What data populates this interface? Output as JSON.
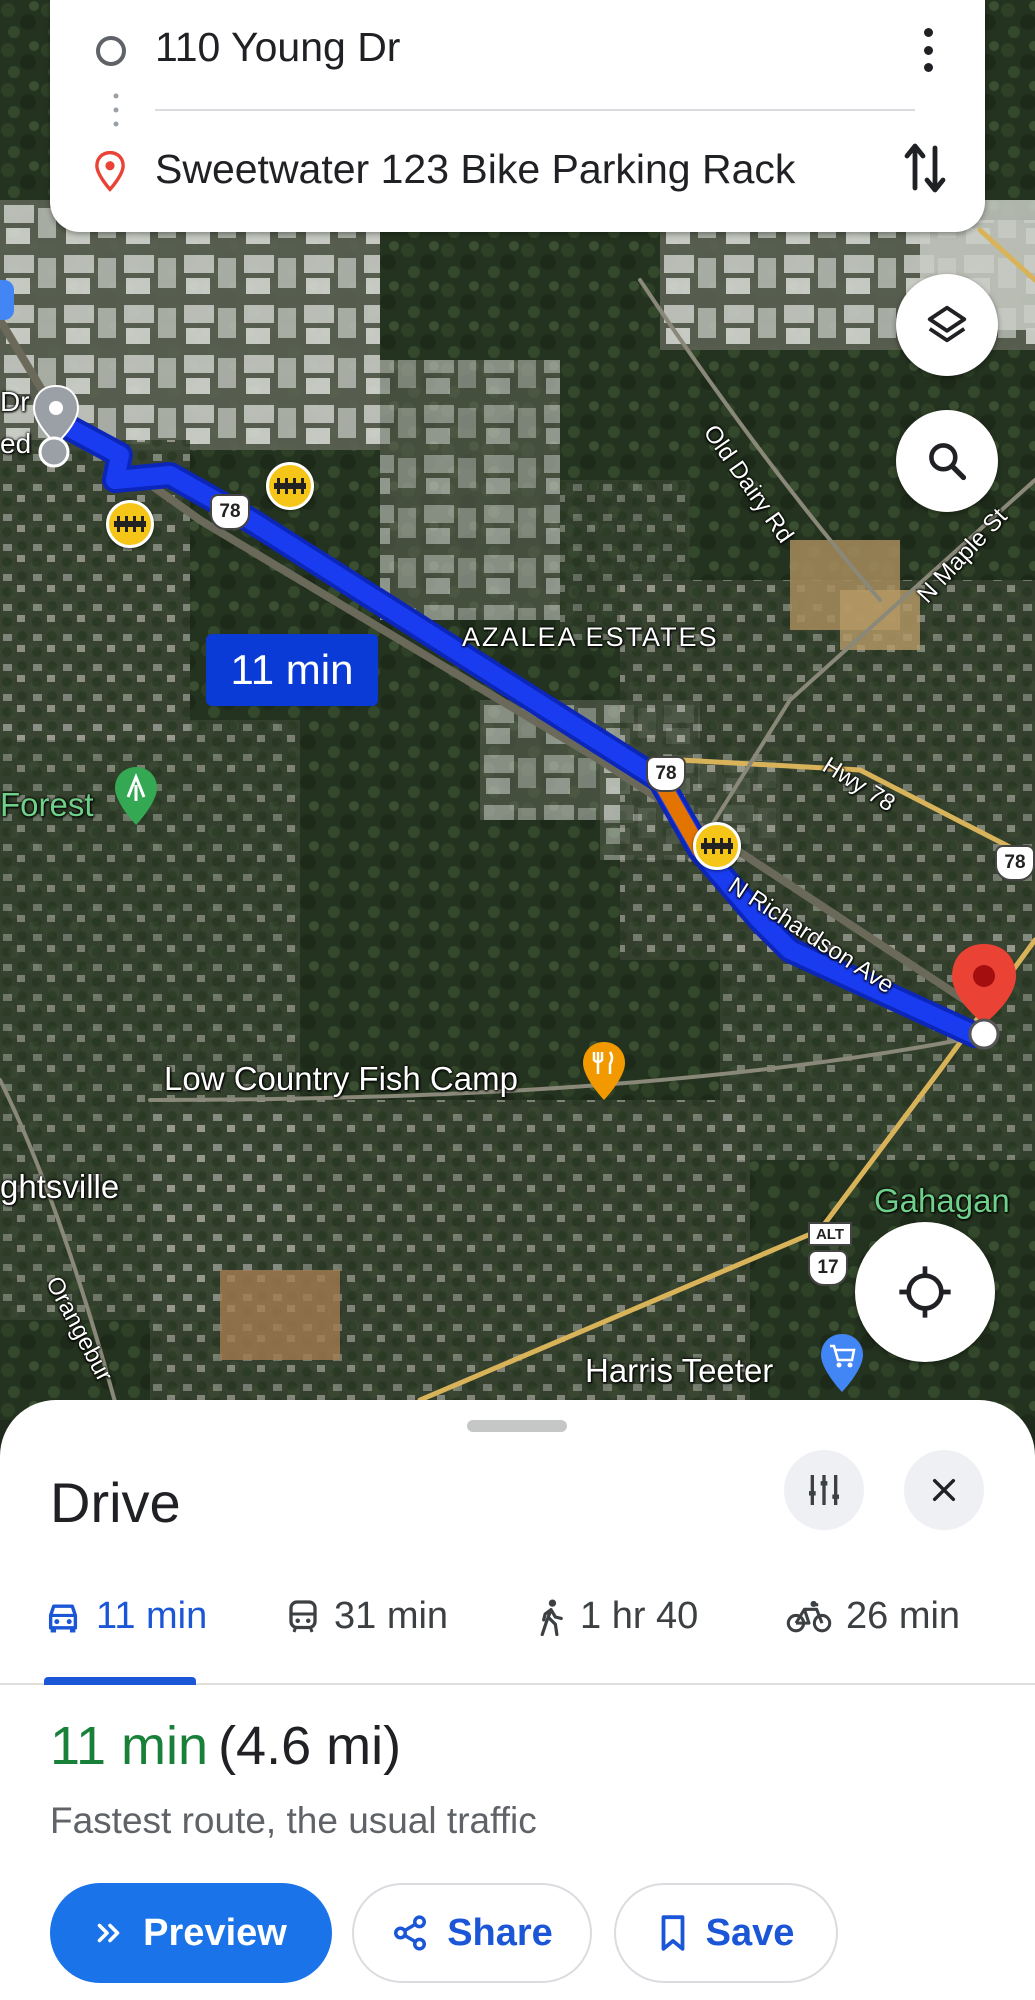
{
  "search": {
    "origin": "110 Young Dr",
    "destination": "Sweetwater 123 Bike Parking Rack"
  },
  "map": {
    "route_time_badge": "11 min",
    "labels": {
      "old_dairy": "Old Dairy Rd",
      "n_maple": "N Maple St",
      "azalea": "AZALEA ESTATES",
      "hwy78": "Hwy 78",
      "n_richardson": "N Richardson Ave",
      "forest": "Forest",
      "low_country": "Low Country Fish Camp",
      "ghtsville": "ghtsville",
      "gahagan": "Gahagan",
      "harris": "Harris Teeter",
      "orangeburg": "Orangebur",
      "edge_dr": "Dr",
      "edge_ed": "ed"
    },
    "shields": {
      "s78a": "78",
      "s78b": "78",
      "s78c": "78",
      "s17": "17",
      "alt": "ALT"
    }
  },
  "sheet": {
    "title": "Drive",
    "modes": [
      {
        "name": "drive",
        "label": "11 min",
        "icon": "car-icon",
        "active": true
      },
      {
        "name": "transit",
        "label": "31 min",
        "icon": "transit-icon",
        "active": false
      },
      {
        "name": "walk",
        "label": "1 hr 40",
        "icon": "walk-icon",
        "active": false
      },
      {
        "name": "bike",
        "label": "26 min",
        "icon": "bike-icon",
        "active": false
      }
    ],
    "summary_duration": "11 min",
    "summary_distance": "(4.6 mi)",
    "route_description": "Fastest route, the usual traffic",
    "buttons": {
      "preview": "Preview",
      "share": "Share",
      "save": "Save"
    }
  },
  "colors": {
    "route": "#1a3cf0",
    "accent": "#1a73e8",
    "duration_green": "#188038",
    "destination_pin": "#ea4335"
  }
}
